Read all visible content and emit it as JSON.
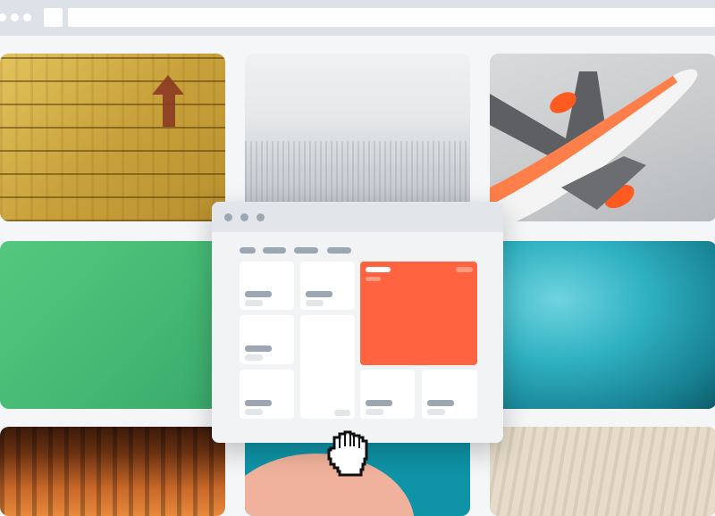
{
  "browser": {
    "window_controls": [
      "dot",
      "dot",
      "dot"
    ],
    "address_bar_text": ""
  },
  "gallery": {
    "tiles": [
      {
        "name": "wood-arrow-photo",
        "icon": "arrow-up-icon"
      },
      {
        "name": "foggy-forest-photo"
      },
      {
        "name": "airplane-photo",
        "icon": "airplane-icon"
      },
      {
        "name": "green-texture-photo"
      },
      {
        "name": "jellyfish-photo"
      },
      {
        "name": "fire-photo"
      },
      {
        "name": "pink-ball-photo"
      },
      {
        "name": "light-wood-photo"
      }
    ]
  },
  "mini_app": {
    "window_controls": [
      "dot",
      "dot",
      "dot"
    ],
    "nav_items": 4,
    "selected_card_color": "#ff6340"
  },
  "colors": {
    "accent": "#ff6340",
    "placeholder": "#9da7b1",
    "chrome": "#dde2e8"
  },
  "cursor": {
    "icon": "grab-hand-icon"
  }
}
